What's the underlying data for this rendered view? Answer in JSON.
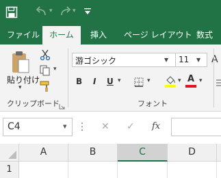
{
  "quick_access": {
    "save": "save-icon",
    "undo": "undo-icon",
    "redo": "redo-icon",
    "customize": "customize-qat-icon"
  },
  "tabs": [
    {
      "label": "ファイル",
      "active": false
    },
    {
      "label": "ホーム",
      "active": true
    },
    {
      "label": "挿入",
      "active": false
    },
    {
      "label": "ページ レイアウト",
      "active": false
    },
    {
      "label": "数式",
      "active": false
    }
  ],
  "clipboard": {
    "paste_label": "貼り付け",
    "group_label": "クリップボード"
  },
  "font": {
    "name": "游ゴシック",
    "size": "11",
    "bold": "B",
    "italic": "I",
    "underline": "U",
    "font_color_letter": "A",
    "grow_letter": "A",
    "group_label": "フォント",
    "highlight_color": "#ffff00",
    "font_color": "#e81123"
  },
  "formula_bar": {
    "name_box": "C4",
    "cancel": "✕",
    "enter": "✓",
    "function": "fx",
    "value": ""
  },
  "sheet": {
    "columns": [
      "A",
      "B",
      "C",
      "D"
    ],
    "selected_column": "C",
    "rows": [
      "1"
    ]
  },
  "colors": {
    "accent": "#217346"
  }
}
